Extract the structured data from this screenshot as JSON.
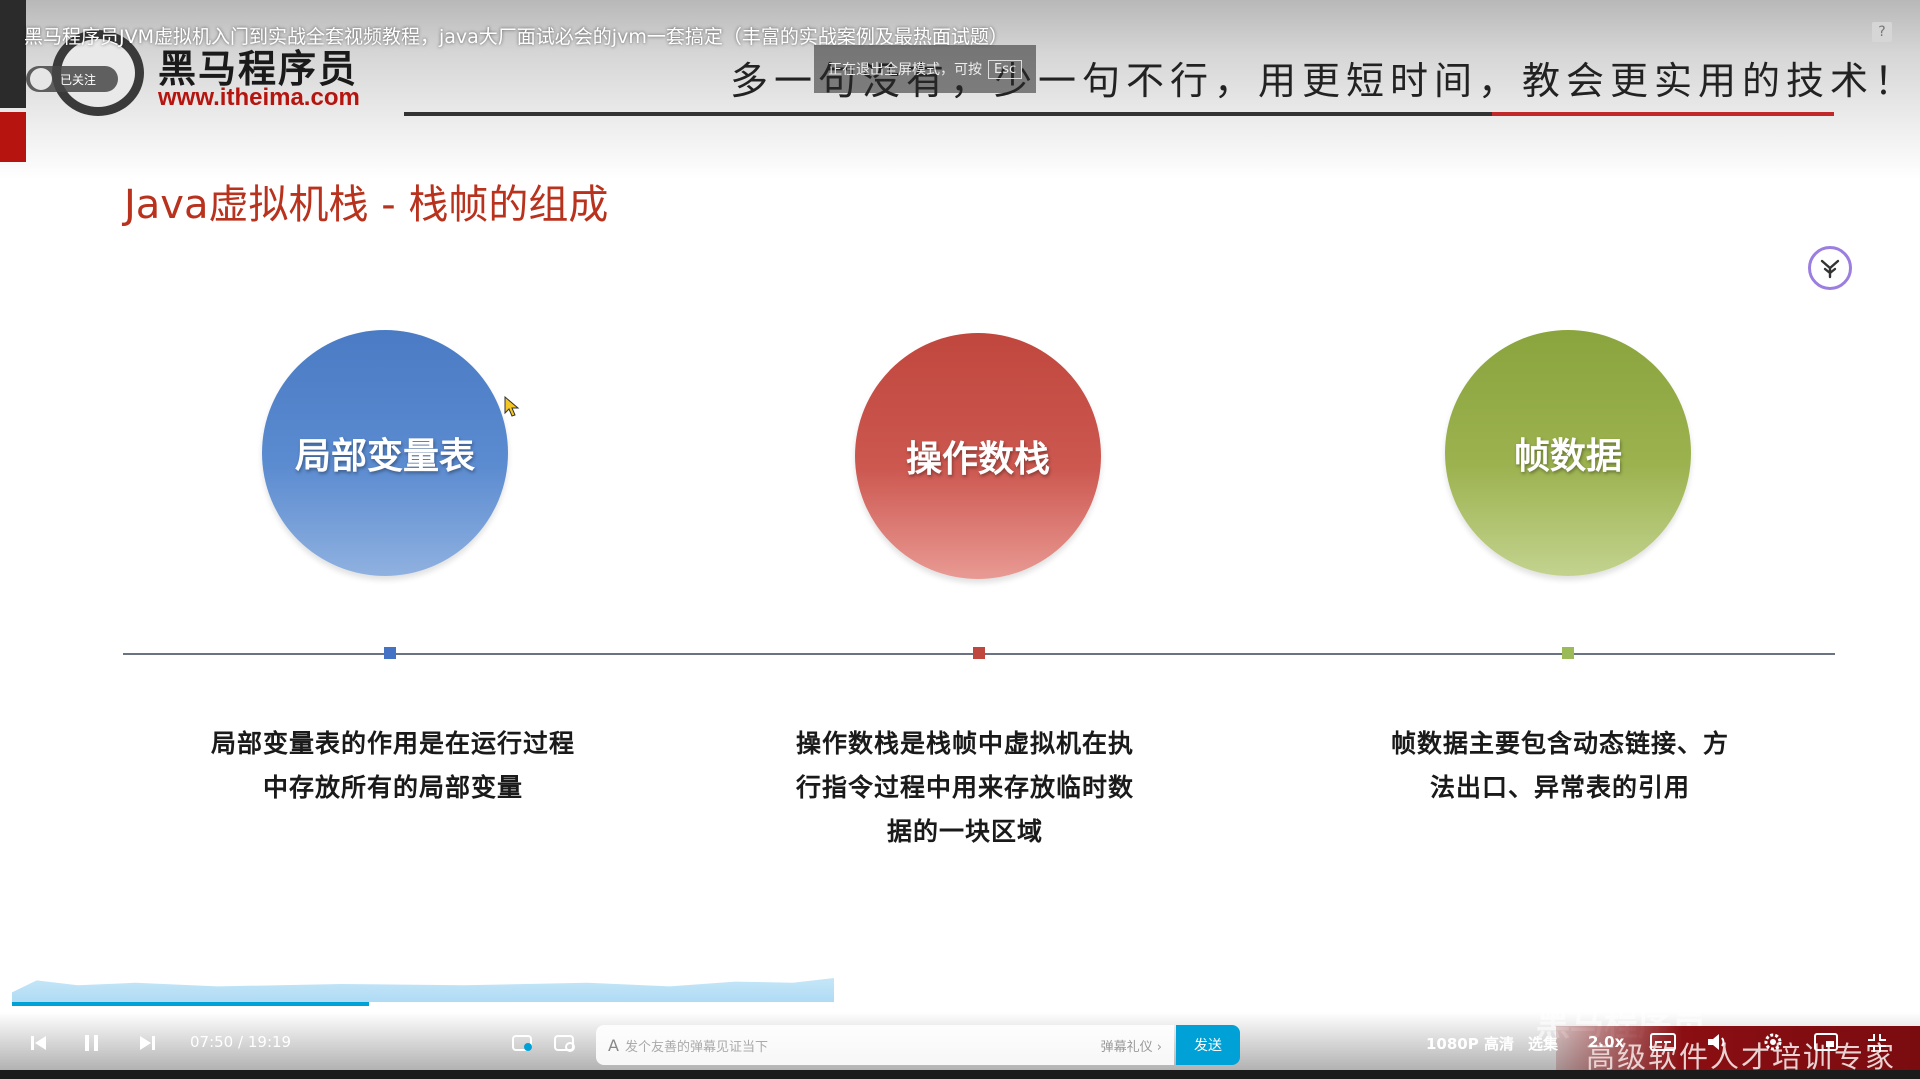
{
  "video": {
    "title": "黑马程序员JVM虚拟机入门到实战全套视频教程，java大厂面试必会的jvm一套搞定（丰富的实战案例及最热面试题）",
    "follow_label": "已关注",
    "help_label": "?",
    "exit_fullscreen_tip": "正在退出全屏模式，可按",
    "exit_fullscreen_key": "Esc"
  },
  "slide": {
    "brand_name": "黑马程序员",
    "brand_url": "www.itheima.com",
    "slogan": "多一句没有，少一句不行，用更短时间，教会更实用的技术！",
    "title": "Java虚拟机栈 - 栈帧的组成",
    "items": [
      {
        "label": "局部变量表",
        "desc_lines": [
          "局部变量表的作用是在运行过程",
          "中存放所有的局部变量"
        ],
        "color": "#4472c4"
      },
      {
        "label": "操作数栈",
        "desc_lines": [
          "操作数栈是栈帧中虚拟机在执",
          "行指令过程中用来存放临时数",
          "据的一块区域"
        ],
        "color": "#c0473e"
      },
      {
        "label": "帧数据",
        "desc_lines": [
          "帧数据主要包含动态链接、方",
          "法出口、异常表的引用"
        ],
        "color": "#9bbb59"
      }
    ],
    "footer": "高级软件人才培训专家"
  },
  "player": {
    "current_time": "07:50",
    "total_time": "19:19",
    "time_separator": "/",
    "progress": 0.405,
    "danmaku_placeholder": "发个友善的弹幕见证当下",
    "danmaku_etiquette": "弹幕礼仪 ›",
    "send_label": "发送",
    "quality_label": "1080P 高清",
    "episodes_label": "选集",
    "speed_label": "2.0x",
    "watermark": "黑马程序员",
    "accent_color": "#00a1d6"
  }
}
